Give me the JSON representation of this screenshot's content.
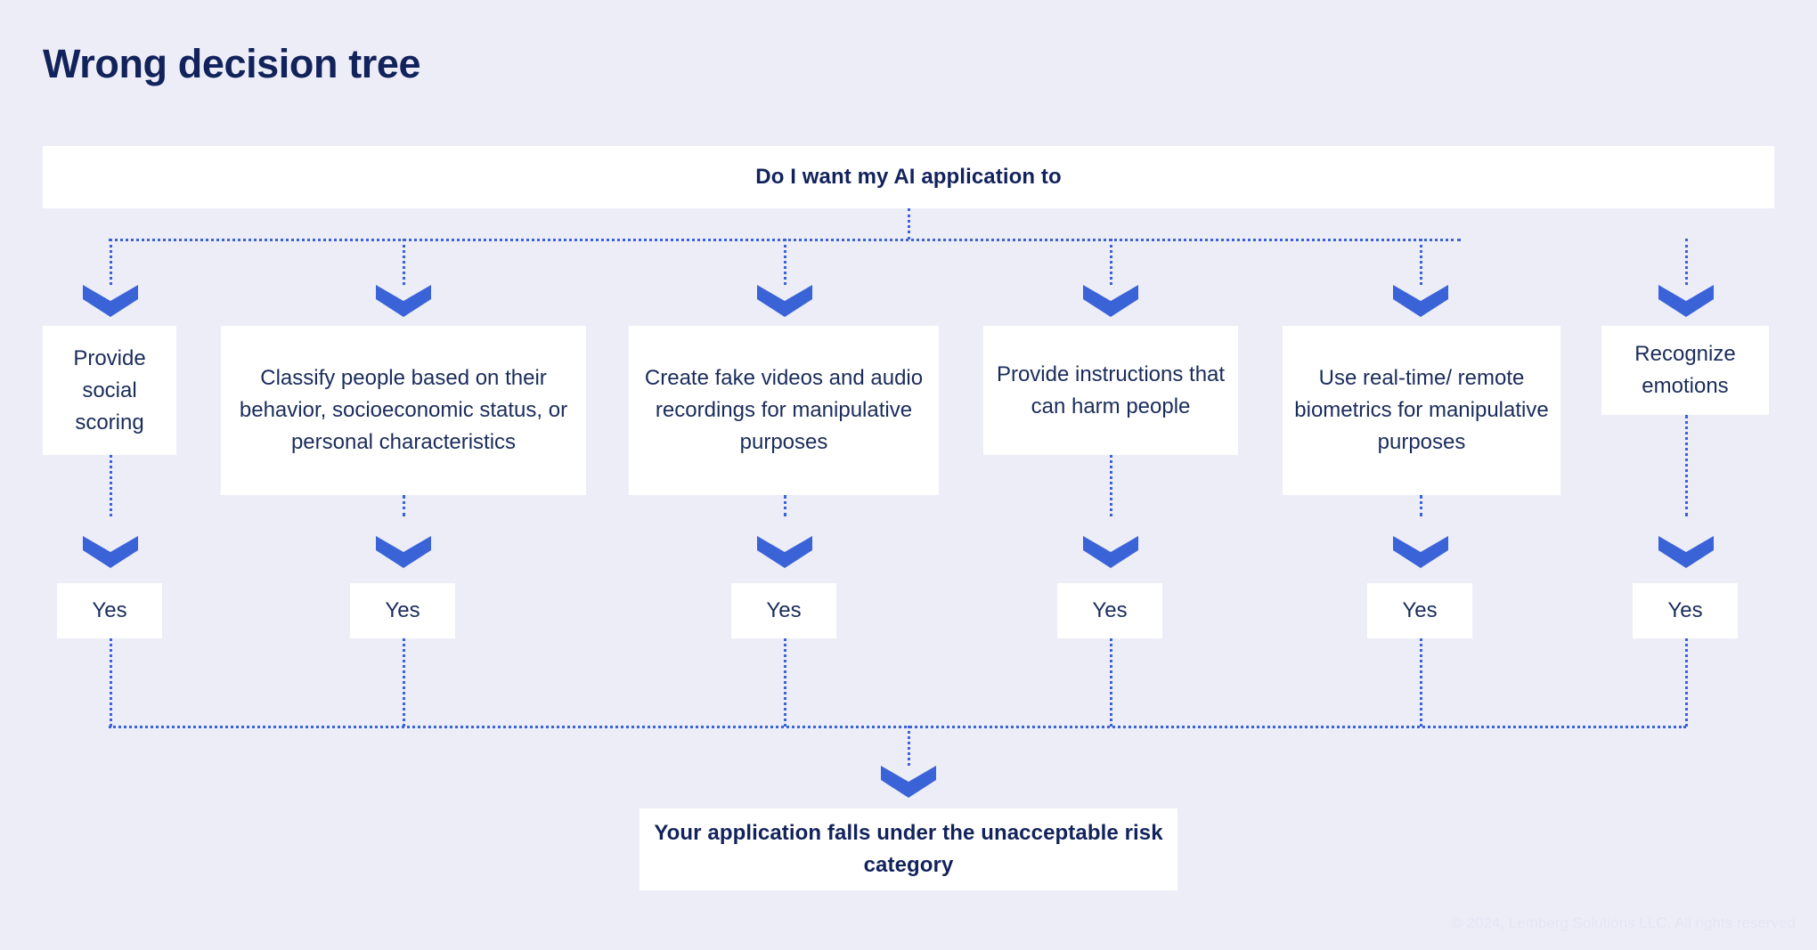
{
  "page": {
    "title": "Wrong decision tree",
    "background_color": "#ededf8",
    "box_color": "#ffffff",
    "accent_color": "#3a63d8",
    "text_color": "#12235c"
  },
  "tree": {
    "root": {
      "label": "Do I want my AI application to"
    },
    "branches": [
      {
        "question": "Provide social scoring",
        "answer": "Yes"
      },
      {
        "question": "Classify people based on their behavior, socioeconomic status, or personal characteristics",
        "answer": "Yes"
      },
      {
        "question": "Create fake videos and audio recordings for manipulative purposes",
        "answer": "Yes"
      },
      {
        "question": "Provide instructions that can harm people",
        "answer": "Yes"
      },
      {
        "question": "Use real-time/ remote biometrics for manipulative purposes",
        "answer": "Yes"
      },
      {
        "question": "Recognize emotions",
        "answer": "Yes"
      }
    ],
    "result": {
      "label": "Your application falls under the unacceptable risk category"
    }
  },
  "footer": {
    "credit": "© 2024, Lemberg Solutions LLC. All rights reserved"
  }
}
